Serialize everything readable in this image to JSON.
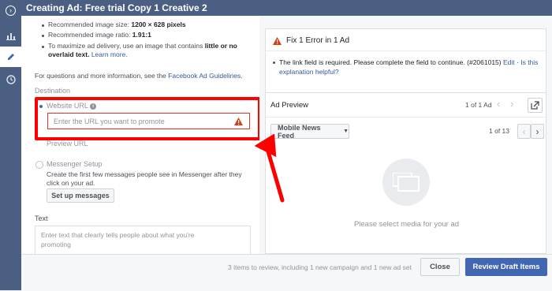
{
  "header": {
    "title": "Creating Ad: Free trial Copy 1 Creative 2"
  },
  "left": {
    "rec_size_prefix": "Recommended image size: ",
    "rec_size_value": "1200 × 628 pixels",
    "rec_ratio_prefix": "Recommended image ratio: ",
    "rec_ratio_value": "1.91:1",
    "max_delivery_text": "To maximize ad delivery, use an image that contains ",
    "max_delivery_bold": "little or no",
    "max_delivery_bold2": "overlaid text.",
    "learn_more": "Learn more.",
    "questions_text": "For questions and more information, see the ",
    "guidelines_link": "Facebook Ad Guidelines.",
    "destination_label": "Destination",
    "website_url_label": "Website URL",
    "url_placeholder": "Enter the URL you want to promote",
    "preview_url_label": "Preview URL",
    "messenger_setup_label": "Messenger Setup",
    "messenger_desc_1": "Create the first few messages people see in Messenger after they",
    "messenger_desc_2": "click on your ad.",
    "setup_messages_btn": "Set up messages",
    "text_label": "Text",
    "text_placeholder_1": "Enter text that clearly tells people about what you're",
    "text_placeholder_2": "promoting"
  },
  "right": {
    "error_title": "Fix 1 Error in 1 Ad",
    "error_text": "The link field is required. Please complete the field to continue. (#2061015)",
    "edit_link": "Edit",
    "explanation_link": "Is this explanation helpful?",
    "ad_preview_label": "Ad Preview",
    "ad_count": "1 of 1 Ad",
    "placement_label": "Mobile News Feed",
    "placement_count": "1 of 13",
    "empty_media": "Please select media for your ad"
  },
  "footer": {
    "review_text": "3 items to review, including 1 new campaign and 1 new ad set",
    "close_btn": "Close",
    "review_btn": "Review Draft Items"
  },
  "colors": {
    "header_bg": "#4b5f83",
    "highlight_red": "#ff0000",
    "primary_blue": "#4267b2",
    "error_red": "#dd3c10"
  }
}
